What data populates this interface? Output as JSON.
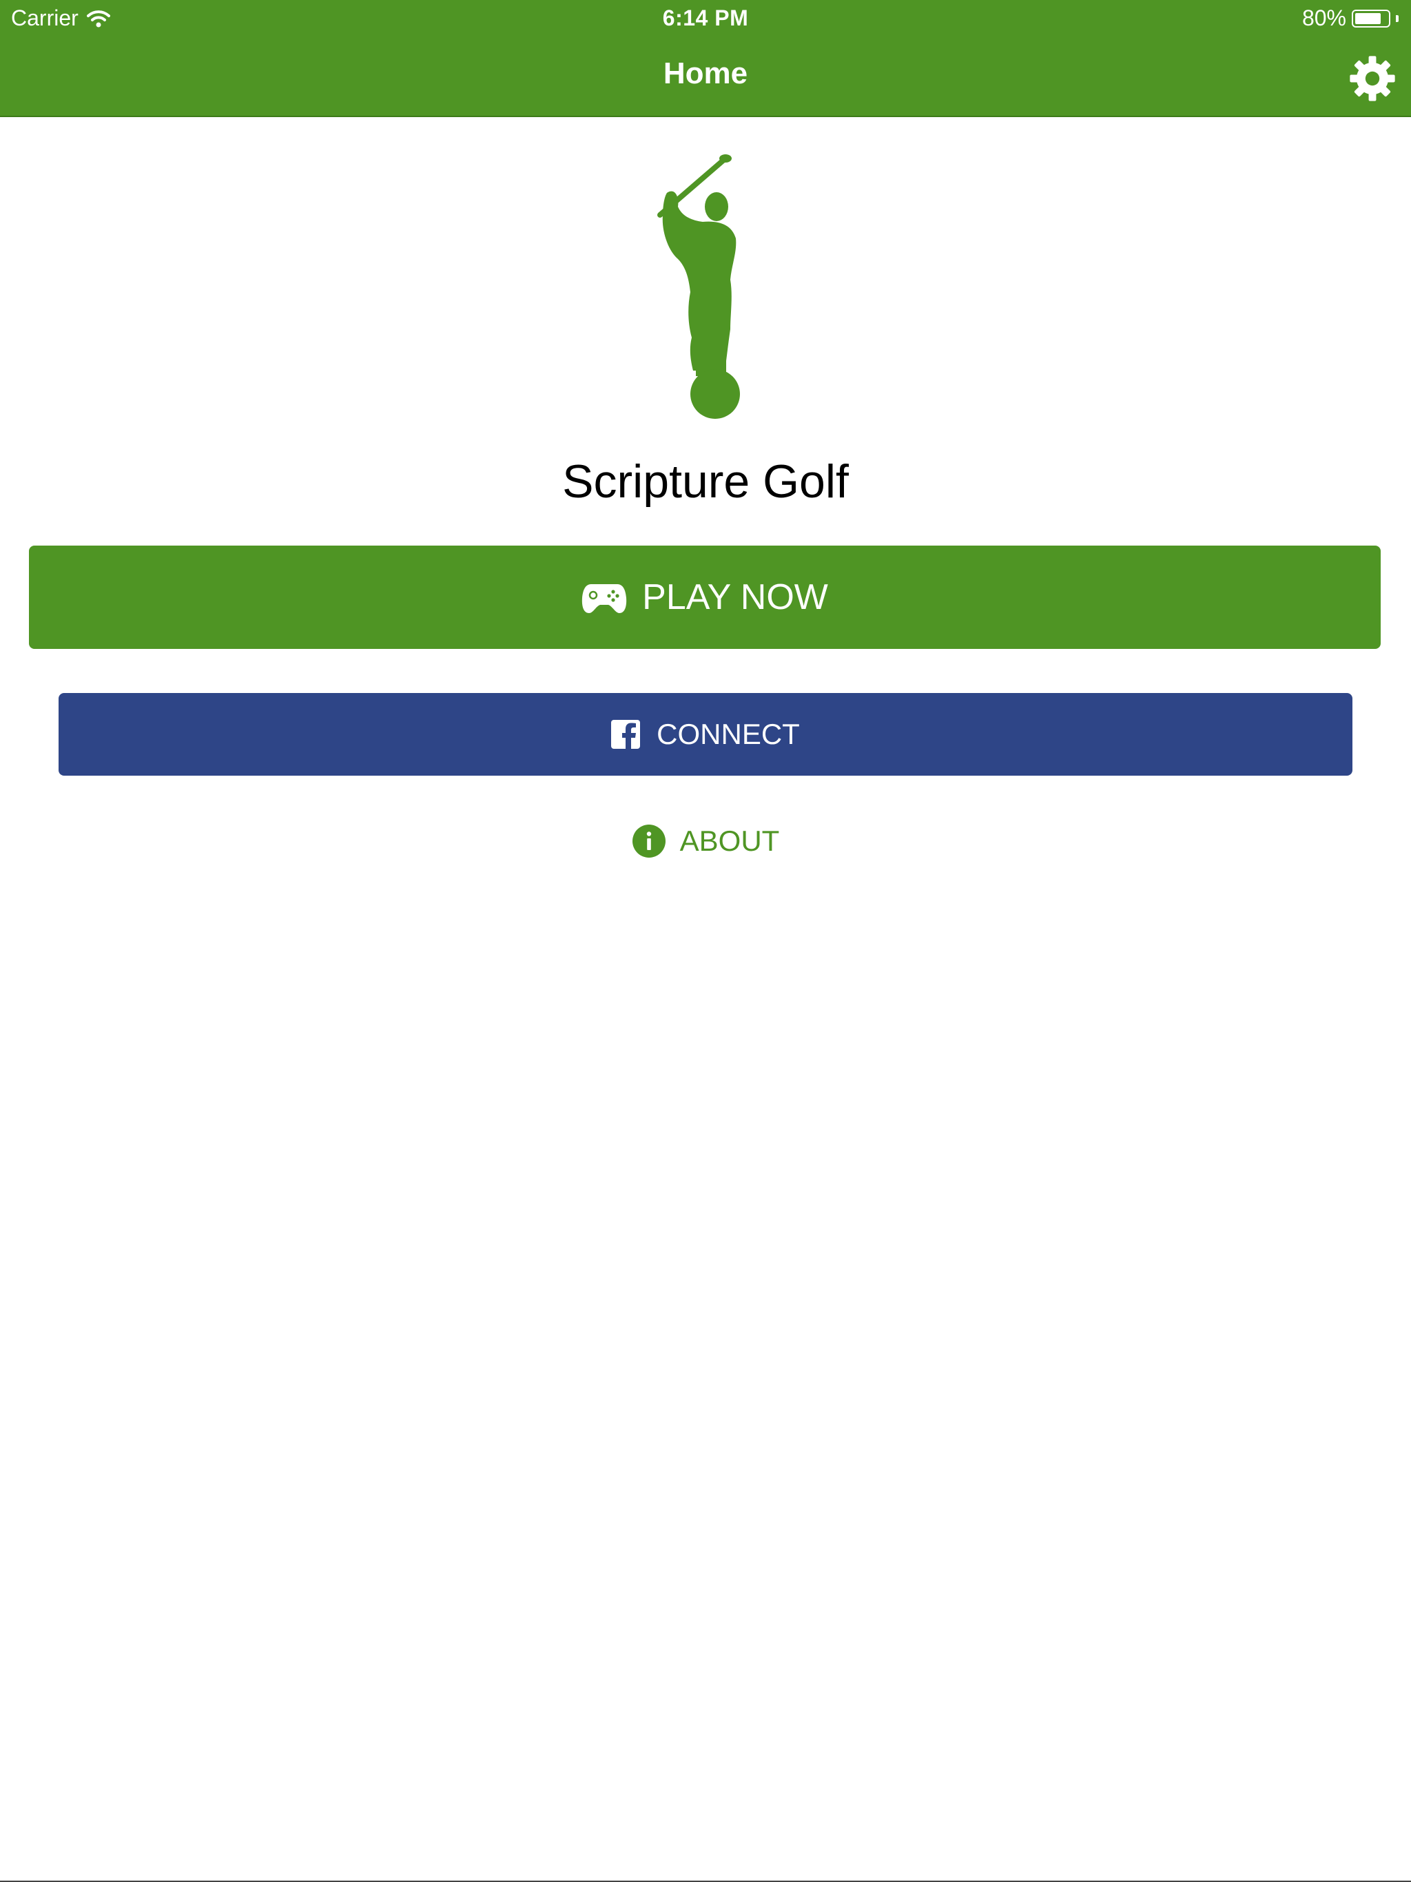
{
  "status_bar": {
    "carrier": "Carrier",
    "time": "6:14 PM",
    "battery_text": "80%",
    "battery_level": 0.8,
    "wifi_icon": "wifi-icon",
    "battery_icon": "battery-icon"
  },
  "nav": {
    "title": "Home",
    "settings_icon": "gear-icon"
  },
  "main": {
    "logo_icon": "golfer-statue-icon",
    "app_title": "Scripture Golf",
    "play_button": {
      "label": "PLAY NOW",
      "icon": "gamepad-icon"
    },
    "connect_button": {
      "label": "CONNECT",
      "icon": "facebook-icon"
    },
    "about_link": {
      "label": "ABOUT",
      "icon": "info-icon"
    }
  },
  "colors": {
    "brand_green": "#4f9524",
    "facebook_blue": "#2e4587",
    "background": "#ffffff"
  }
}
